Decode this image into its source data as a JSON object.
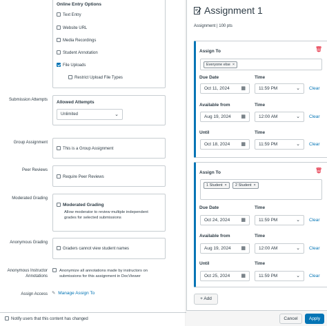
{
  "settings": {
    "online_entry": {
      "heading": "Online Entry Options",
      "options": [
        {
          "label": "Text Entry",
          "checked": false
        },
        {
          "label": "Website URL",
          "checked": false
        },
        {
          "label": "Media Recordings",
          "checked": false
        },
        {
          "label": "Student Annotation",
          "checked": false
        },
        {
          "label": "File Uploads",
          "checked": true
        },
        {
          "label": "Restrict Upload File Types",
          "checked": false
        }
      ]
    },
    "submission_attempts": {
      "label": "Submission Attempts",
      "heading": "Allowed Attempts",
      "value": "Unlimited"
    },
    "group_assignment": {
      "label": "Group Assignment",
      "option": "This is a Group Assignment"
    },
    "peer_reviews": {
      "label": "Peer Reviews",
      "option": "Require Peer Reviews"
    },
    "moderated_grading": {
      "label": "Moderated Grading",
      "option": "Moderated Grading",
      "description_line1": "Allow moderator to review multiple independent",
      "description_line2": "grades for selected submissions"
    },
    "anonymous_grading": {
      "label": "Anonymous Grading",
      "option": "Graders cannot view student names"
    },
    "anonymous_instructor": {
      "label_line1": "Anonymous Instructor",
      "label_line2": "Annotations",
      "option_line1": "Anonymize all annotations made by instructors on",
      "option_line2": "submissions for this assignment in DocViewer"
    },
    "assign_access": {
      "label": "Assign Access",
      "link": "Manage Assign To"
    },
    "notify": {
      "label": "Notify users that this content has changed",
      "checked": false
    }
  },
  "tray": {
    "title": "Assignment 1",
    "subtitle": "Assignment | 100 pts",
    "cards": [
      {
        "assign_to_label": "Assign To",
        "tags": [
          "Everyone else"
        ],
        "due_date_label": "Due Date",
        "due_date": "Oct 11, 2024",
        "due_time_label": "Time",
        "due_time": "11:59 PM",
        "available_from_label": "Available from",
        "available_from": "Aug 19, 2024",
        "available_time_label": "Time",
        "available_time": "12:00 AM",
        "until_label": "Until",
        "until": "Oct 18, 2024",
        "until_time_label": "Time",
        "until_time": "11:59 PM",
        "clear_label": "Clear"
      },
      {
        "assign_to_label": "Assign To",
        "tags": [
          "1 Student",
          "2 Student"
        ],
        "due_date_label": "Due Date",
        "due_date": "Oct 24, 2024",
        "due_time_label": "Time",
        "due_time": "11:59 PM",
        "available_from_label": "Available from",
        "available_from": "Aug 19, 2024",
        "available_time_label": "Time",
        "available_time": "12:00 AM",
        "until_label": "Until",
        "until": "Oct 25, 2024",
        "until_time_label": "Time",
        "until_time": "11:59 PM",
        "clear_label": "Clear"
      }
    ],
    "add_label": "Add",
    "cancel_label": "Cancel",
    "apply_label": "Apply"
  },
  "colors": {
    "accent": "#0374b5",
    "danger": "#e0061f",
    "border": "#c7cdd1",
    "text": "#2d3b45"
  },
  "icons": [
    "edit-assignment-icon",
    "trash-icon",
    "remove-tag-icon",
    "calendar-icon",
    "chevron-down-icon",
    "plus-icon",
    "pencil-icon",
    "checkbox-icon"
  ]
}
